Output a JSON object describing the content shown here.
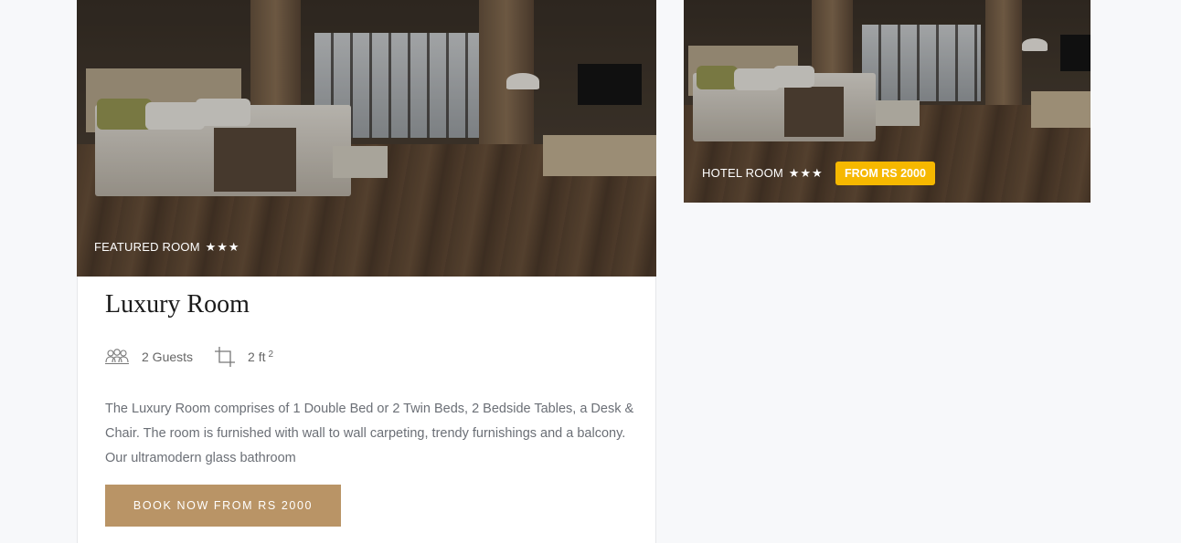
{
  "featured": {
    "tag_label": "FEATURED ROOM",
    "tag_stars": "★★★",
    "title": "Luxury Room",
    "guests_label": "2 Guests",
    "area_value": "2 ft",
    "area_unit_sup": "2",
    "description": "The Luxury Room comprises of 1 Double Bed or 2 Twin Beds, 2 Bedside Tables, a Desk & Chair. The room is furnished with wall to wall carpeting, trendy furnishings and a balcony. Our ultramodern glass bathroom",
    "book_button": "BOOK NOW FROM RS 2000"
  },
  "side_room": {
    "tag_label": "HOTEL ROOM",
    "tag_stars": "★★★",
    "price_badge": "FROM RS 2000"
  },
  "colors": {
    "accent_button": "#b99466",
    "price_badge": "#f6b800",
    "page_background": "#f7f8fa"
  },
  "icons": {
    "guests": "guests-icon",
    "area": "crop-area-icon",
    "star": "star-icon"
  }
}
